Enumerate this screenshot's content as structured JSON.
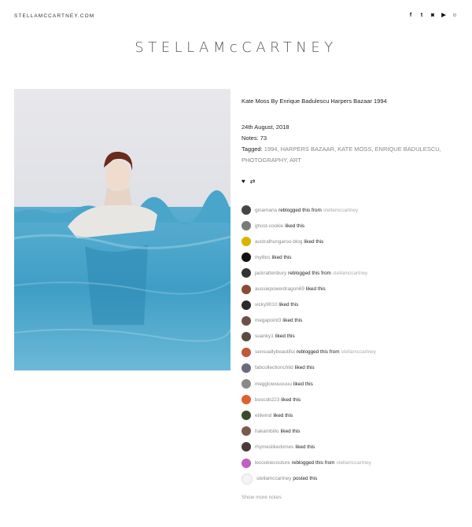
{
  "header": {
    "site_link": "STELLAMCCARTNEY.COM",
    "logo_text": "STELLAMcCARTNEY",
    "social": [
      {
        "icon": "facebook-icon",
        "glyph": "f"
      },
      {
        "icon": "twitter-icon",
        "glyph": "t"
      },
      {
        "icon": "instagram-icon",
        "glyph": "◙"
      },
      {
        "icon": "youtube-icon",
        "glyph": "▶"
      },
      {
        "icon": "snapchat-icon",
        "glyph": "☺"
      }
    ]
  },
  "post": {
    "caption": "Kate Moss By Enrique Badulescu Harpers Bazaar 1994",
    "date": "24th August, 2018",
    "notes_label": "Notes: 73",
    "tagged_label": "Tagged:",
    "tags": [
      "1994",
      "HARPERS BAZAAR",
      "KATE MOSS",
      "ENRIQUE BADULESCU",
      "PHOTOGRAPHY",
      "ART"
    ],
    "like_icon": "heart-icon",
    "reblog_icon": "reblog-icon"
  },
  "notes": [
    {
      "user": "ginamaria",
      "action": "reblogged this from",
      "source": "stellamccartney",
      "color": "#444444"
    },
    {
      "user": "ghost-cookie",
      "action": "liked this",
      "source": "",
      "color": "#7a7a7a"
    },
    {
      "user": "australhungaroo-blog",
      "action": "liked this",
      "source": "",
      "color": "#d8b400"
    },
    {
      "user": "myillos",
      "action": "liked this",
      "source": "",
      "color": "#111111"
    },
    {
      "user": "jackrattenbury",
      "action": "reblogged this from",
      "source": "stellamccartney",
      "color": "#333333"
    },
    {
      "user": "aussiepowerdragon69",
      "action": "liked this",
      "source": "",
      "color": "#8a4a3a"
    },
    {
      "user": "vicky9010",
      "action": "liked this",
      "source": "",
      "color": "#2a2a2a"
    },
    {
      "user": "megapoint3",
      "action": "liked this",
      "source": "",
      "color": "#6a5048"
    },
    {
      "user": "suanky1",
      "action": "liked this",
      "source": "",
      "color": "#5a4a40"
    },
    {
      "user": "sensuallybeautiful",
      "action": "reblogged this from",
      "source": "stellamccartney",
      "color": "#c2563a"
    },
    {
      "user": "fabcollectionchild",
      "action": "liked this",
      "source": "",
      "color": "#6a6a7a"
    },
    {
      "user": "megglowuuuuuu",
      "action": "liked this",
      "source": "",
      "color": "#8a8a8a"
    },
    {
      "user": "boscob223",
      "action": "liked this",
      "source": "",
      "color": "#e06030"
    },
    {
      "user": "etilwind",
      "action": "liked this",
      "source": "",
      "color": "#3a4a2a"
    },
    {
      "user": "hakambillo",
      "action": "liked this",
      "source": "",
      "color": "#7a5a4a"
    },
    {
      "user": "rhymeslikedvmes",
      "action": "liked this",
      "source": "",
      "color": "#4a3a3a"
    },
    {
      "user": "lecookiecouture",
      "action": "reblogged this from",
      "source": "stellamccartney",
      "color": "#c060c0"
    },
    {
      "user": "stellamccartney",
      "action": "posted this",
      "source": "",
      "color": "#f4f4f4"
    }
  ],
  "show_more": "Show more notes"
}
